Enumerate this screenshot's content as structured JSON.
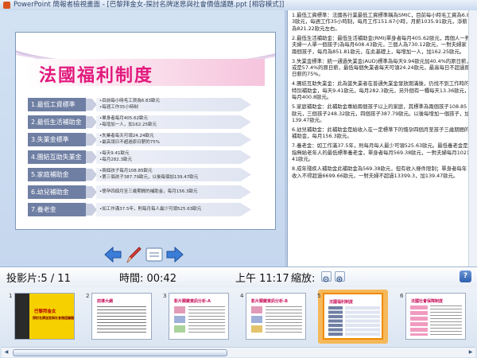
{
  "window": {
    "title": "PowerPoint 簡報者檢視畫面 - [巴黎拜金女-探討名牌迷思與社會價值議題.ppt [相容模式]]"
  },
  "slide": {
    "title": "法國福利制度",
    "rows": [
      {
        "label": "1.最低工資標準",
        "lines": [
          "•目前每小時毛工資為6.83歐元",
          "•每週工作35小時制"
        ]
      },
      {
        "label": "2.最低生活補助金",
        "lines": [
          "•單身者每月405.62歐元",
          "•每增加一人，加162.25歐元"
        ]
      },
      {
        "label": "3.失業金標準",
        "lines": [
          "•失業者每天可領24.24歐元",
          "•最高領日不超過原日薪的75%"
        ]
      },
      {
        "label": "4.團結互助失業金",
        "lines": [
          "•每天9.41歐元",
          "•每月282.3歐元"
        ]
      },
      {
        "label": "5.家庭補助金",
        "lines": [
          "•兩個孩子每月108.85歐元",
          "•第三個孩子387.79歐元，以後每個加139.47歐元"
        ]
      },
      {
        "label": "6.幼兒補助金",
        "lines": [
          "•懷孕四個月至三歲期間的補助金，每月156.3歐元"
        ]
      },
      {
        "label": "7.養老金",
        "lines": [
          "•如工作滿37.5年，則每月每人最少可領525.63歐元"
        ]
      }
    ]
  },
  "status": {
    "slide_label": "投影片:5 / 11",
    "time_label": "時間: 00:42",
    "clock": "上午 11:17",
    "zoom_label": "縮放:"
  },
  "notes": [
    "1.最低工資標準：法國各行業最低工資標準稱為SMIC，目前每小時毛工資為6.83歐元，每週工作35小時制，每月工作151.67小時，月薪1035.91歐元，淨薪為821.22歐元左右。",
    "2.最低生活補助金：最低生活補助金(RMI)單身者每月405.62歐元，再個人一對夫婦一人單一個孩子)為每月608.43歐元，三個人為730.12歐元，一對夫婦家兩個孩子，每月為851.81歐元，在此基礎上，每增加一人，加162.25歐元。",
    "3.失業金標準：統一通過失業金(AUD)標準為每天9.94歐元加40.4%的原日薪，或是57.4%的原日薪，最低每個失業者每天可領24.24歐元，最高每日不超過原日薪的75%。",
    "4.團結互助失業金：此為當失業者在普通失業金發放期滿後，仍找不到工作時的特別補助金，每天9.41歐元，每月282.3歐元，另外個有一種每天13.36歐元，每月400.8歐元。",
    "5.家庭補助金：此補助金專給兩個孩子以上的家庭，其標準為兩個孩子108.85歐元，三個孩子248.32歐元，四個孩子387.79歐元。以後每增加一個孩子，加139.47歐元。",
    "6.幼兒補助金：此補助金是給收入在一定標準下的懷孕四個月至孩子三歲期間的補助金，每月156.3歐元。",
    "7.養老金：如工作滿37.5年，則每月每人最少可領525.63歐元。最低養老金是指無給老年人的最低標準養老金，單身者每月569.38歐元，一對夫婦每月1021.41歐元。",
    "8.成年殘疾人補助金此補助金為569.38歐元，但有收入條件限制；單身者每年收入不得超過6699.66歐元，一對夫婦不超過13399.3，加139.47歐元。"
  ],
  "thumbnails": [
    {
      "num": "1",
      "title": "巴黎拜金女",
      "subtitle": "探討名牌迷思與社會價值議題",
      "bg": "#f7d000"
    },
    {
      "num": "2",
      "title": "前導大綱",
      "subtitle": "",
      "bg": "#ffffff"
    },
    {
      "num": "3",
      "title": "影片關鍵資訊分析-A",
      "subtitle": "",
      "bg": "#ffffff"
    },
    {
      "num": "4",
      "title": "影片關鍵資訊分析-B",
      "subtitle": "",
      "bg": "#ffffff"
    },
    {
      "num": "5",
      "title": "法國福利制度",
      "subtitle": "",
      "bg": "#ffffff"
    },
    {
      "num": "6",
      "title": "法國社會保障制度",
      "subtitle": "",
      "bg": "#ffffff"
    }
  ],
  "colors": {
    "title_pink": "#e2197d",
    "label_fill": "#6f7fa3",
    "selected_border": "#f08a00"
  }
}
